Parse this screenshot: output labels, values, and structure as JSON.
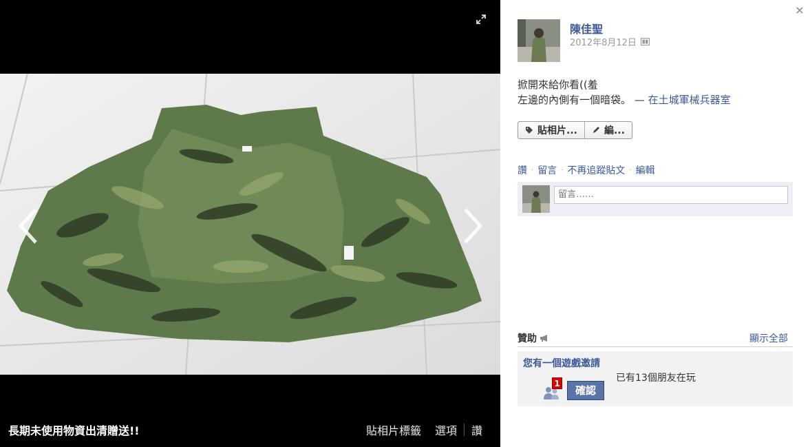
{
  "photo": {
    "caption": "長期未使用物資出清贈送!!",
    "actions": [
      "貼相片標籤",
      "選項",
      "讚"
    ]
  },
  "post": {
    "author": "陳佳聖",
    "date": "2012年8月12日",
    "line1": "掀開來給你看((羞",
    "line2": "左邊的內側有一個暗袋。",
    "dash": " — ",
    "location": "在土城軍械兵器室"
  },
  "buttons": {
    "tag_photo": "貼相片...",
    "edit": "編..."
  },
  "links": [
    "讚",
    "留言",
    "不再追蹤貼文",
    "編輯"
  ],
  "comment": {
    "placeholder": "留言……"
  },
  "sponsored": {
    "title": "贊助",
    "show_all": "顯示全部",
    "game_invite_title": "您有一個遊戲邀請",
    "friends_playing": "已有13個朋友在玩",
    "badge_count": "1",
    "confirm_label": "確認"
  },
  "icons": {
    "expand": "expand-icon",
    "prev": "chevron-left-icon",
    "next": "chevron-right-icon",
    "close": "close-icon",
    "audience": "friends-audience-icon",
    "tag": "tag-icon",
    "pencil": "pencil-icon",
    "megaphone": "megaphone-icon",
    "people": "people-icon"
  },
  "colors": {
    "link": "#3b5998",
    "stage_bg": "#000000",
    "confirm_bg": "#5b74a8"
  }
}
